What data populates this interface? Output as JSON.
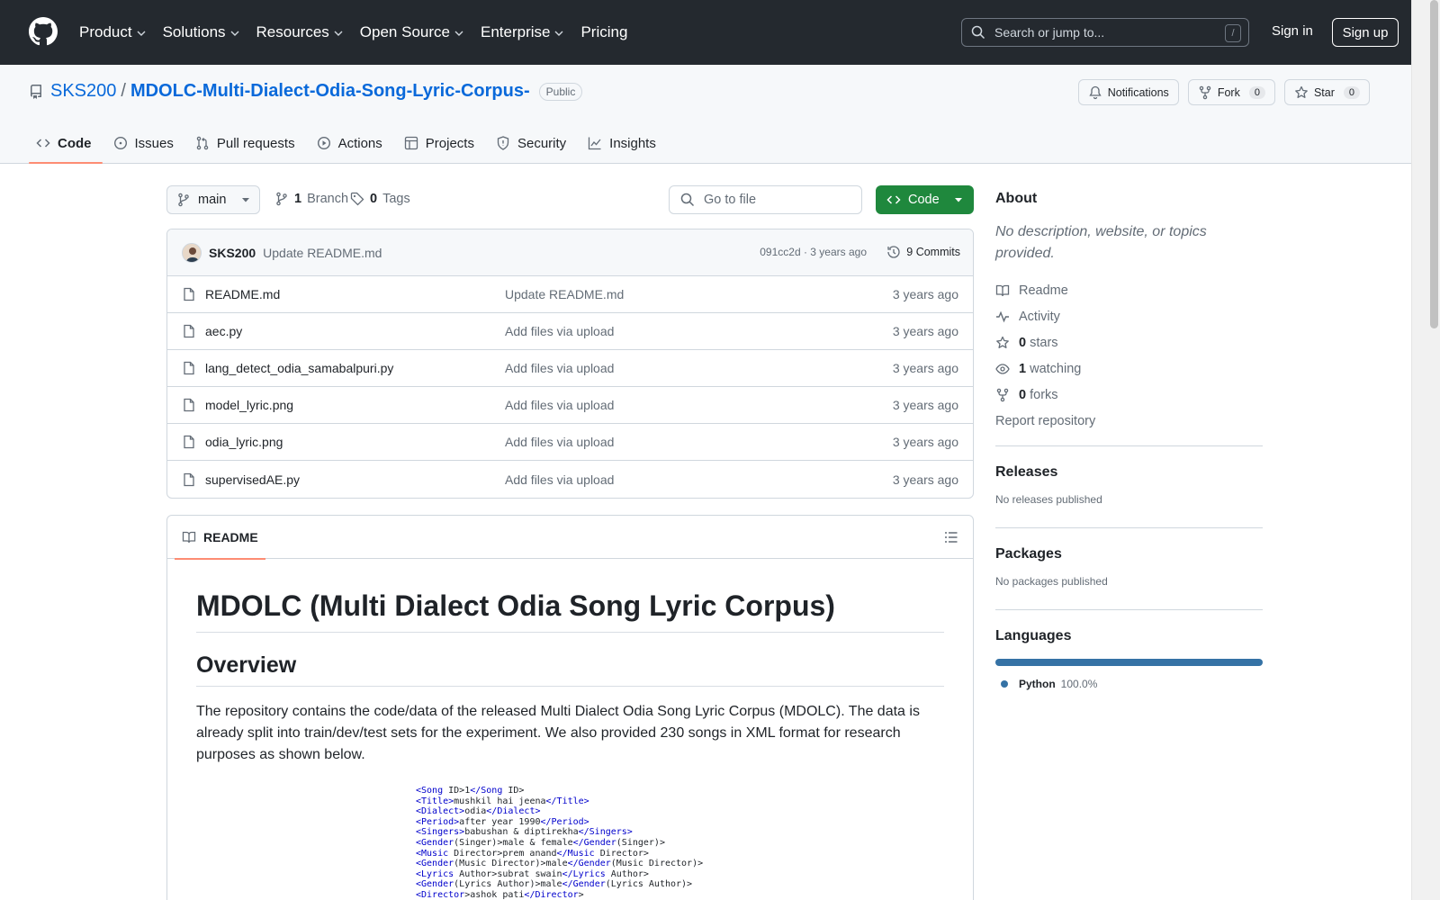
{
  "header": {
    "nav": [
      "Product",
      "Solutions",
      "Resources",
      "Open Source",
      "Enterprise",
      "Pricing"
    ],
    "search_placeholder": "Search or jump to...",
    "search_key": "/",
    "signin": "Sign in",
    "signup": "Sign up"
  },
  "repo": {
    "owner": "SKS200",
    "separator": "/",
    "name": "MDOLC-Multi-Dialect-Odia-Song-Lyric-Corpus-",
    "visibility": "Public",
    "notifications": "Notifications",
    "fork_label": "Fork",
    "fork_count": "0",
    "star_label": "Star",
    "star_count": "0"
  },
  "tabs": [
    "Code",
    "Issues",
    "Pull requests",
    "Actions",
    "Projects",
    "Security",
    "Insights"
  ],
  "branch": {
    "current": "main",
    "branch_count": "1",
    "branch_label": "Branch",
    "tag_count": "0",
    "tag_label": "Tags",
    "goto_placeholder": "Go to file",
    "code_label": "Code"
  },
  "commit": {
    "author": "SKS200",
    "message": "Update README.md",
    "meta": "091cc2d · 3 years ago",
    "commits": "9 Commits"
  },
  "files": [
    {
      "name": "README.md",
      "message": "Update README.md",
      "date": "3 years ago"
    },
    {
      "name": "aec.py",
      "message": "Add files via upload",
      "date": "3 years ago"
    },
    {
      "name": "lang_detect_odia_samabalpuri.py",
      "message": "Add files via upload",
      "date": "3 years ago"
    },
    {
      "name": "model_lyric.png",
      "message": "Add files via upload",
      "date": "3 years ago"
    },
    {
      "name": "odia_lyric.png",
      "message": "Add files via upload",
      "date": "3 years ago"
    },
    {
      "name": "supervisedAE.py",
      "message": "Add files via upload",
      "date": "3 years ago"
    }
  ],
  "readme": {
    "tab_label": "README",
    "h1": "MDOLC (Multi Dialect Odia Song Lyric Corpus)",
    "h2": "Overview",
    "paragraph": "The repository contains the code/data of the released Multi Dialect Odia Song Lyric Corpus (MDOLC). The data is already split into train/dev/test sets for the experiment. We also provided 230 songs in XML format for research purposes as shown below.",
    "xml_lines": [
      {
        "open": "<Song",
        "text": " ID>1",
        "close": "</Song",
        "tail": " ID>"
      },
      {
        "open": "<Title>",
        "text": "mushkil hai jeena",
        "close": "</Title>",
        "tail": ""
      },
      {
        "open": "<Dialect>",
        "text": "odia",
        "close": "</Dialect>",
        "tail": ""
      },
      {
        "open": "<Period>",
        "text": "after year 1990",
        "close": "</Period>",
        "tail": ""
      },
      {
        "open": "<Singers>",
        "text": "babushan & diptirekha",
        "close": "</Singers>",
        "tail": ""
      },
      {
        "open": "<Gender",
        "text": "(Singer)>male & female",
        "close": "</Gender",
        "tail": "(Singer)>"
      },
      {
        "open": "<Music",
        "text": " Director>prem anand",
        "close": "</Music",
        "tail": " Director>"
      },
      {
        "open": "<Gender",
        "text": "(Music Director)>male",
        "close": "</Gender",
        "tail": "(Music Director)>"
      },
      {
        "open": "<Lyrics",
        "text": " Author>subrat swain",
        "close": "</Lyrics",
        "tail": " Author>"
      },
      {
        "open": "<Gender",
        "text": "(Lyrics Author)>male",
        "close": "</Gender",
        "tail": "(Lyrics Author)>"
      },
      {
        "open": "<Director",
        "text": ">ashok pati",
        "close": "</Director",
        "tail": ">"
      }
    ]
  },
  "sidebar": {
    "about_title": "About",
    "about_text": "No description, website, or topics provided.",
    "items": [
      {
        "icon": "book-icon",
        "bold": "",
        "label": "Readme"
      },
      {
        "icon": "pulse-icon",
        "bold": "",
        "label": "Activity"
      },
      {
        "icon": "star-icon",
        "bold": "0",
        "label": "stars"
      },
      {
        "icon": "eye-icon",
        "bold": "1",
        "label": "watching"
      },
      {
        "icon": "fork-icon",
        "bold": "0",
        "label": "forks"
      }
    ],
    "report": "Report repository",
    "releases_title": "Releases",
    "releases_text": "No releases published",
    "packages_title": "Packages",
    "packages_text": "No packages published",
    "languages_title": "Languages",
    "language_name": "Python",
    "language_pct": "100.0%",
    "language_fraction": 1.0,
    "language_color": "#3572A5"
  },
  "colors": {
    "header_bg": "#24292f",
    "link": "#0969da",
    "code_button": "#1f883d",
    "tab_underline": "#fd8c73"
  }
}
